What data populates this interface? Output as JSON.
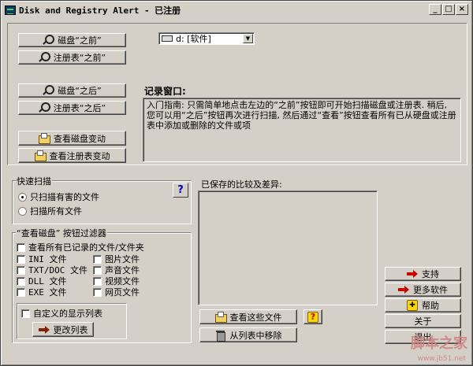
{
  "window": {
    "title": "Disk and Registry Alert - 已注册",
    "controls": [
      "_",
      "□",
      "×"
    ]
  },
  "top": {
    "drive_value": "d: [软件]",
    "before_disk": "磁盘“之前”",
    "before_reg": "注册表“之前”",
    "after_disk": "磁盘“之后”",
    "after_reg": "注册表“之后”",
    "view_disk_changes": "查看磁盘变动",
    "view_reg_changes": "查看注册表变动",
    "log_label": "记录窗口:",
    "log_text": "入门指南:  只需简单地点击左边的“之前”按钮即可开始扫描磁盘或注册表. 稍后, 您可以用“之后”按钮再次进行扫描, 然后通过“查看”按钮查看所有已从硬盘或注册表中添加或删除的文件或项"
  },
  "quick_scan": {
    "title": "快速扫描",
    "help": "?",
    "options": [
      "只扫描有害的文件",
      "扫描所有文件"
    ],
    "selected": 0
  },
  "filter": {
    "title": "“查看磁盘” 按钮过滤器",
    "show_all": "查看所有已记录的文件/文件夹",
    "left": [
      "INI 文件",
      "TXT/DOC 文件",
      "DLL 文件",
      "EXE 文件"
    ],
    "right": [
      "图片文件",
      "声音文件",
      "视频文件",
      "网页文件"
    ],
    "custom_list": "自定义的显示列表",
    "change_list": "更改列表"
  },
  "saved": {
    "label": "已保存的比较及差异:",
    "view_files": "查看这些文件",
    "help": "?",
    "remove": "从列表中移除"
  },
  "side": {
    "support": "支持",
    "more_software": "更多软件",
    "help": "帮助",
    "about": "关于",
    "exit": "退出"
  },
  "watermark": {
    "brand": "脚本之家",
    "url": "www.jb51.net"
  }
}
